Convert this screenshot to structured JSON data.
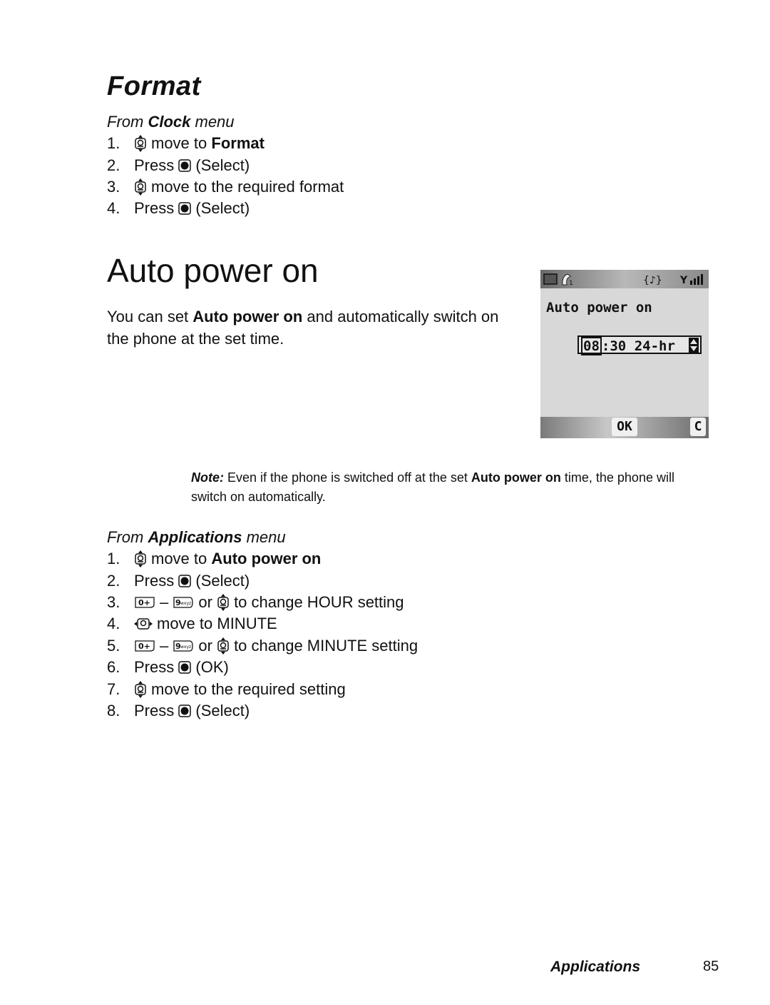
{
  "format_section": {
    "heading": "Format",
    "from_prefix": "From ",
    "from_menu": "Clock",
    "from_suffix": " menu",
    "steps": [
      {
        "num": "1.",
        "icon": "nav-up-down-icon",
        "text": "move to ",
        "bold": "Format"
      },
      {
        "num": "2.",
        "prefix": "Press ",
        "icon": "select-key-icon",
        "text": "(Select)"
      },
      {
        "num": "3.",
        "icon": "nav-up-down-icon",
        "text": "move to the required format"
      },
      {
        "num": "4.",
        "prefix": "Press ",
        "icon": "select-key-icon",
        "text": "(Select)"
      }
    ]
  },
  "auto_power_section": {
    "heading": "Auto power on",
    "intro_before": "You can set ",
    "intro_bold": "Auto power on",
    "intro_after": " and automatically switch on the phone at the set time.",
    "note_label": "Note:",
    "note_before": " Even if the phone is switched off at the set ",
    "note_bold": "Auto power on",
    "note_after": " time, the phone will switch on automatically.",
    "from_prefix": "From ",
    "from_menu": "Applications",
    "from_suffix": " menu",
    "steps": [
      {
        "num": "1.",
        "text": "move to ",
        "bold": "Auto power on"
      },
      {
        "num": "2.",
        "prefix": "Press ",
        "text": "(Select)"
      },
      {
        "num": "3.",
        "key_start": "0+",
        "dash": "–",
        "key_end": "9wxyz",
        "or": "or",
        "text": "to change HOUR setting"
      },
      {
        "num": "4.",
        "text": "move to MINUTE"
      },
      {
        "num": "5.",
        "key_start": "0+",
        "dash": "–",
        "key_end": "9wxyz",
        "or": "or",
        "text": "to change MINUTE setting"
      },
      {
        "num": "6.",
        "prefix": "Press ",
        "text": "(OK)"
      },
      {
        "num": "7.",
        "text": "move to the required setting"
      },
      {
        "num": "8.",
        "prefix": "Press ",
        "text": "(Select)"
      }
    ]
  },
  "phone_screen": {
    "title": "Auto power on",
    "hour": "08",
    "separator": ":",
    "minute": "30",
    "mode": "24-hr",
    "softkey_left": "OK",
    "softkey_right": "C"
  },
  "footer": {
    "section": "Applications",
    "page": "85"
  }
}
